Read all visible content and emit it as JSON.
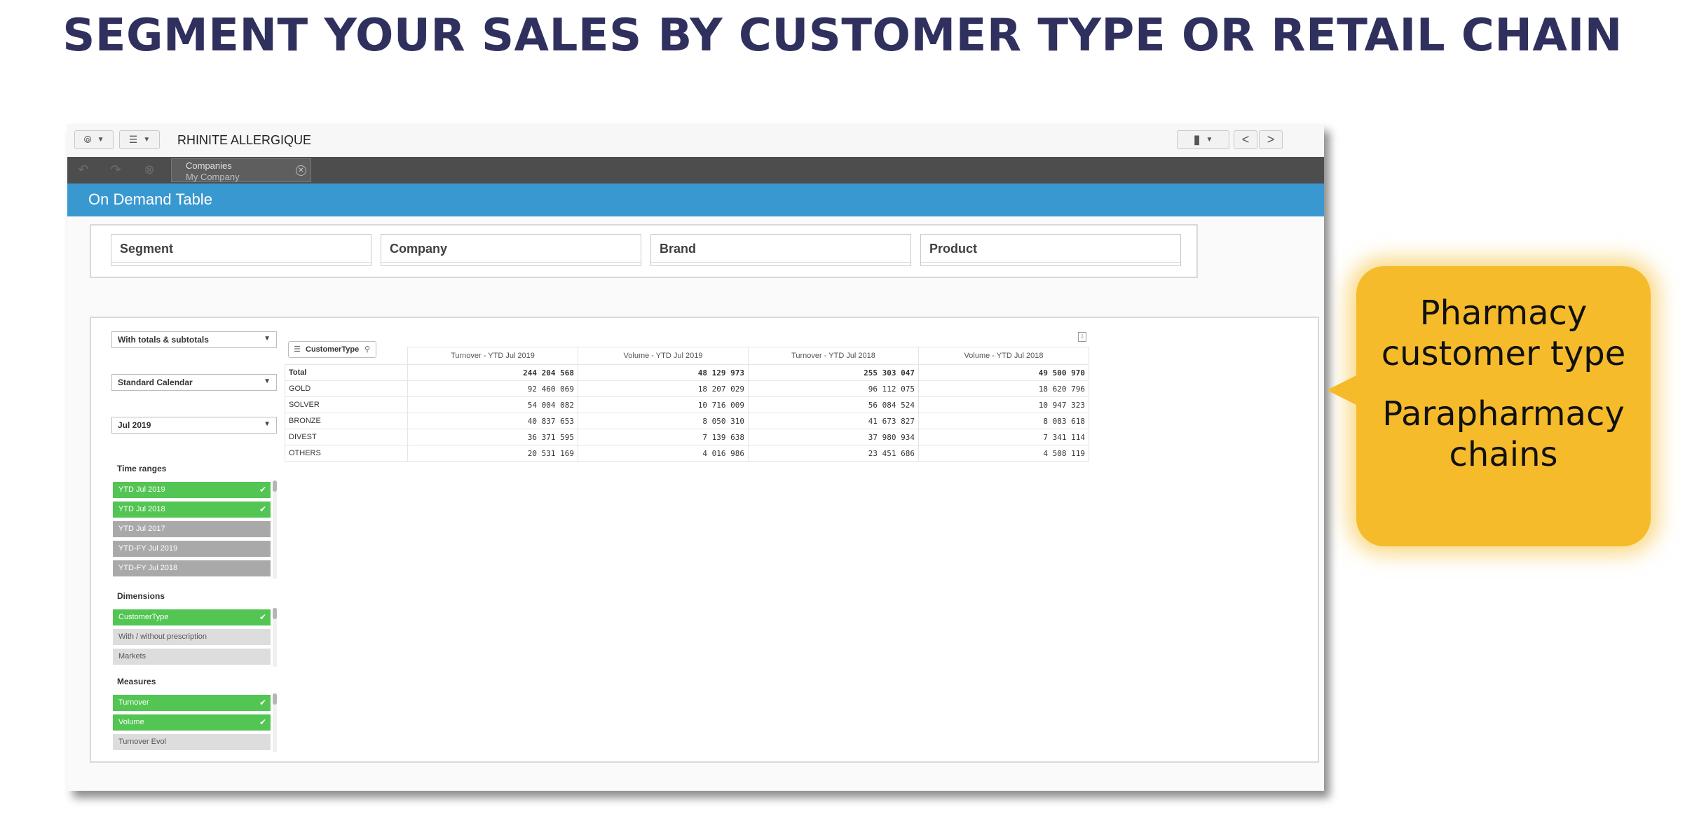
{
  "slide": {
    "title": "SEGMENT YOUR SALES BY CUSTOMER TYPE OR RETAIL CHAIN"
  },
  "toolbar": {
    "app_name": "RHINITE ALLERGIQUE",
    "nav_icon": "compass-icon",
    "list_icon": "list-icon",
    "bookmark_icon": "bookmark-icon",
    "prev_label": "<",
    "next_label": ">"
  },
  "selection_bar": {
    "field": "Companies",
    "value": "My Company"
  },
  "sheet": {
    "title": "On Demand Table"
  },
  "filters": [
    "Segment",
    "Company",
    "Brand",
    "Product"
  ],
  "controls": {
    "totals_dropdown": "With totals & subtotals",
    "calendar_dropdown": "Standard Calendar",
    "period_dropdown": "Jul 2019"
  },
  "time_ranges": {
    "title": "Time ranges",
    "items": [
      {
        "label": "YTD Jul 2019",
        "state": "selected"
      },
      {
        "label": "YTD Jul 2018",
        "state": "selected"
      },
      {
        "label": "YTD Jul 2017",
        "state": "excluded"
      },
      {
        "label": "YTD-FY Jul 2019",
        "state": "excluded"
      },
      {
        "label": "YTD-FY Jul 2018",
        "state": "excluded"
      }
    ]
  },
  "dimensions": {
    "title": "Dimensions",
    "items": [
      {
        "label": "CustomerType",
        "state": "selected"
      },
      {
        "label": "With / without prescription",
        "state": "alternative"
      },
      {
        "label": "Markets",
        "state": "alternative"
      }
    ]
  },
  "measures": {
    "title": "Measures",
    "items": [
      {
        "label": "Turnover",
        "state": "selected"
      },
      {
        "label": "Volume",
        "state": "selected"
      },
      {
        "label": "Turnover Evol",
        "state": "alternative"
      }
    ]
  },
  "table": {
    "dimension_label": "CustomerType",
    "columns": [
      "Turnover - YTD Jul 2019",
      "Volume - YTD Jul 2019",
      "Turnover - YTD Jul 2018",
      "Volume - YTD Jul 2018"
    ],
    "rows": [
      {
        "label": "Total",
        "values": [
          "244 204 568",
          "48 129 973",
          "255 303 047",
          "49 500 970"
        ]
      },
      {
        "label": "GOLD",
        "values": [
          "92 460 069",
          "18 207 029",
          "96 112 075",
          "18 620 796"
        ]
      },
      {
        "label": "SOLVER",
        "values": [
          "54 004 082",
          "10 716 009",
          "56 084 524",
          "10 947 323"
        ]
      },
      {
        "label": "BRONZE",
        "values": [
          "40 837 653",
          "8 050 310",
          "41 673 827",
          "8 083 618"
        ]
      },
      {
        "label": "DIVEST",
        "values": [
          "36 371 595",
          "7 139 638",
          "37 980 934",
          "7 341 114"
        ]
      },
      {
        "label": "OTHERS",
        "values": [
          "20 531 169",
          "4 016 986",
          "23 451 686",
          "4 508 119"
        ]
      }
    ]
  },
  "callout": {
    "line1": "Pharmacy",
    "line2": "customer type",
    "line3": "Parapharmacy",
    "line4": "chains",
    "color": "#f5bb2a"
  },
  "colors": {
    "header_blue": "#3a98d0",
    "selected_green": "#52c552",
    "title_navy": "#30305e"
  }
}
